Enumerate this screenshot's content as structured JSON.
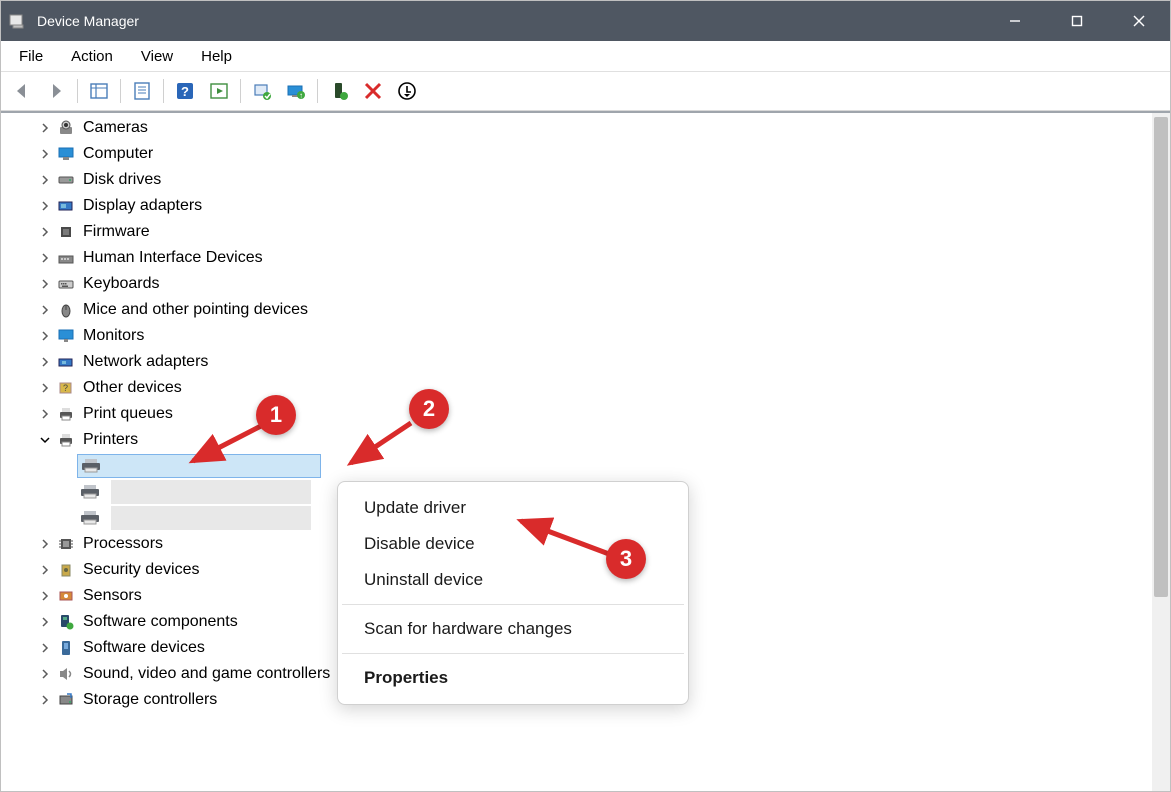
{
  "window": {
    "title": "Device Manager"
  },
  "menu": {
    "file": "File",
    "action": "Action",
    "view": "View",
    "help": "Help"
  },
  "tree": {
    "items": [
      {
        "label": "Cameras"
      },
      {
        "label": "Computer"
      },
      {
        "label": "Disk drives"
      },
      {
        "label": "Display adapters"
      },
      {
        "label": "Firmware"
      },
      {
        "label": "Human Interface Devices"
      },
      {
        "label": "Keyboards"
      },
      {
        "label": "Mice and other pointing devices"
      },
      {
        "label": "Monitors"
      },
      {
        "label": "Network adapters"
      },
      {
        "label": "Other devices"
      },
      {
        "label": "Print queues"
      },
      {
        "label": "Printers"
      },
      {
        "label": "Processors"
      },
      {
        "label": "Security devices"
      },
      {
        "label": "Sensors"
      },
      {
        "label": "Software components"
      },
      {
        "label": "Software devices"
      },
      {
        "label": "Sound, video and game controllers"
      },
      {
        "label": "Storage controllers"
      }
    ]
  },
  "context_menu": {
    "update_driver": "Update driver",
    "disable_device": "Disable device",
    "uninstall_device": "Uninstall device",
    "scan": "Scan for hardware changes",
    "properties": "Properties"
  },
  "annotations": {
    "a1": "1",
    "a2": "2",
    "a3": "3"
  }
}
